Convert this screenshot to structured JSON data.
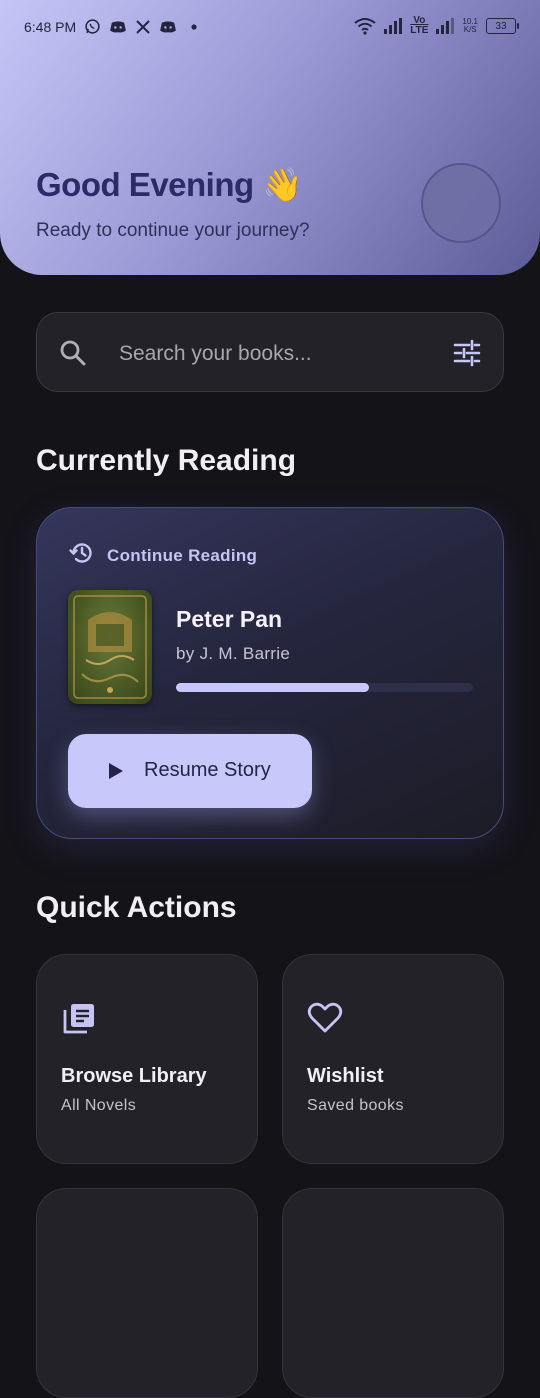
{
  "status_bar": {
    "time": "6:48 PM",
    "left_icons": [
      "whatsapp-icon",
      "discord-icon",
      "x-icon",
      "discord-icon",
      "dot-icon"
    ],
    "right_icons": [
      "wifi-icon",
      "signal-icon",
      "volte-icon",
      "signal-icon"
    ],
    "volte_top": "Vo",
    "volte_bottom": "LTE",
    "speed_top": "10.1",
    "speed_bottom": "K/S",
    "battery": "33"
  },
  "header": {
    "greeting": "Good Evening",
    "greeting_emoji": "👋",
    "subtitle": "Ready to continue your journey?"
  },
  "search": {
    "placeholder": "Search your books...",
    "value": ""
  },
  "currently_reading": {
    "section_title": "Currently Reading",
    "continue_label": "Continue Reading",
    "book_title": "Peter Pan",
    "book_author": "by J. M. Barrie",
    "progress": 0.65,
    "resume_label": "Resume Story"
  },
  "quick_actions": {
    "section_title": "Quick Actions",
    "items": [
      {
        "title": "Browse Library",
        "subtitle": "All Novels",
        "icon": "library-books-icon"
      },
      {
        "title": "Wishlist",
        "subtitle": "Saved books",
        "icon": "heart-icon"
      }
    ]
  },
  "colors": {
    "accent": "#c8c7fb",
    "background": "#141318",
    "card": "#232228",
    "header_start": "#c5c6f6",
    "header_end": "#5c5c98"
  }
}
